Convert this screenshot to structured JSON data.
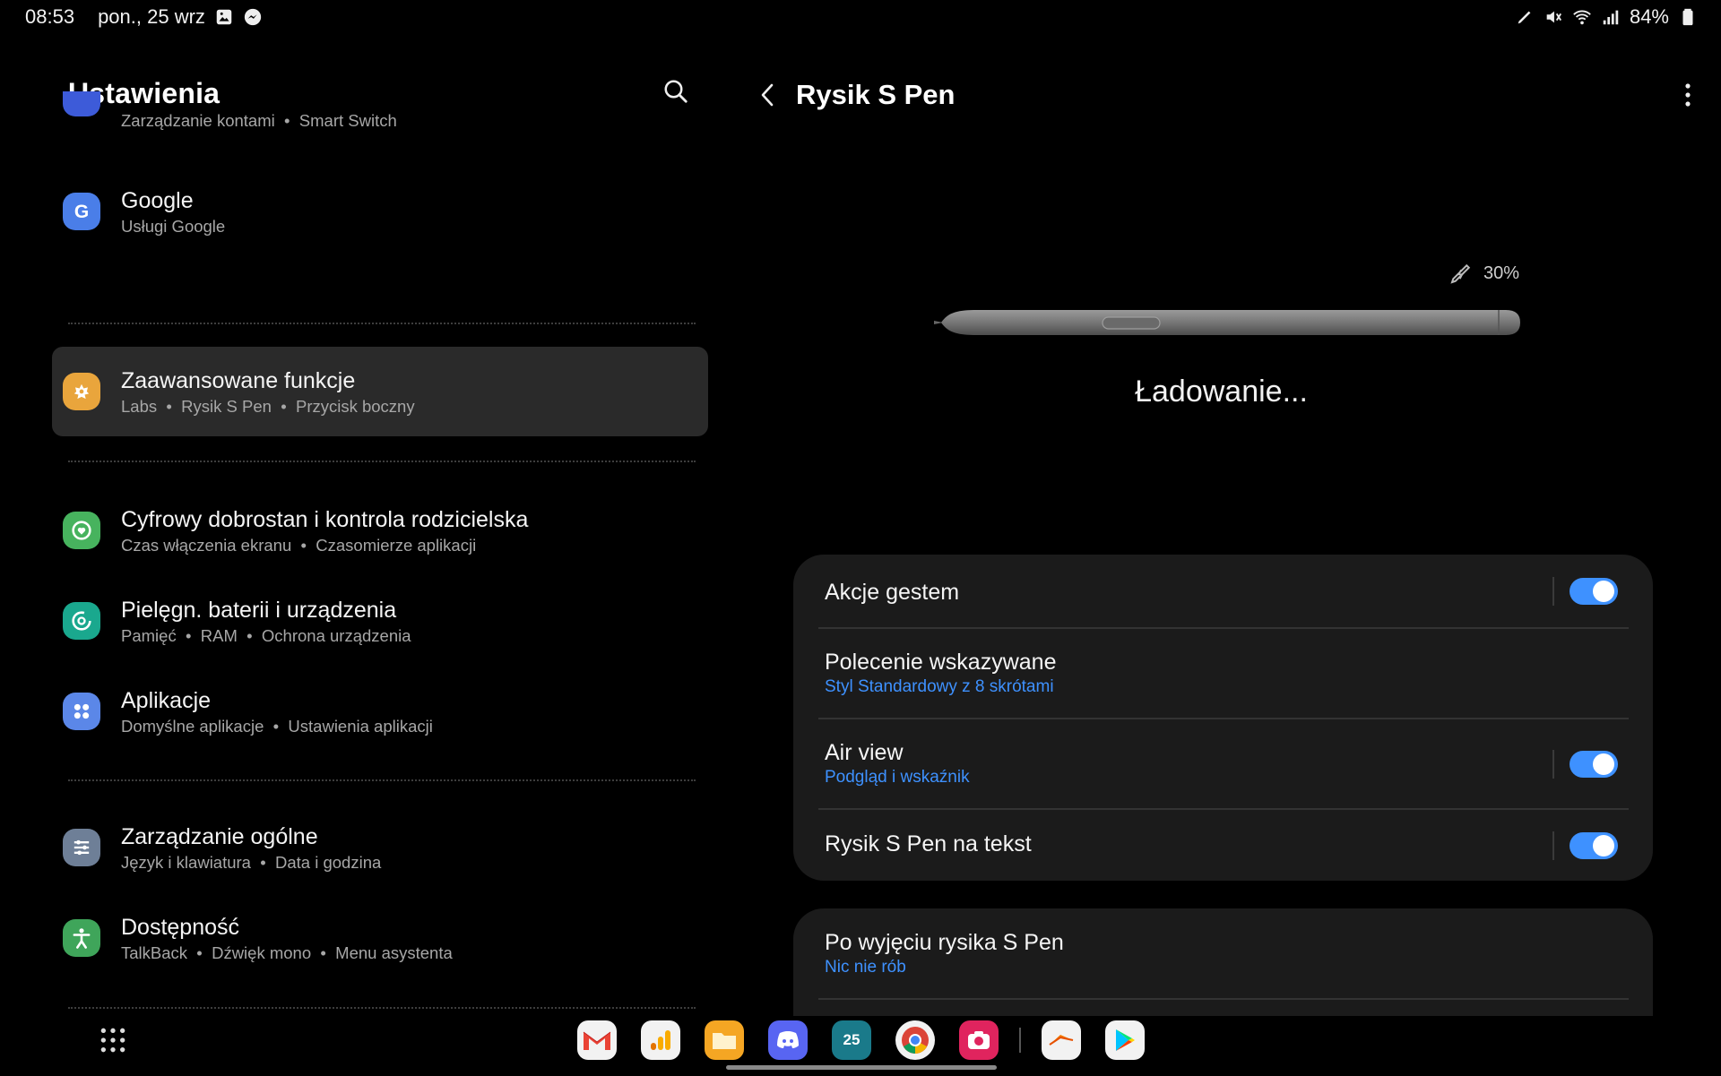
{
  "status_bar": {
    "time": "08:53",
    "date": "pon., 25 wrz",
    "battery": "84%"
  },
  "left": {
    "title": "Ustawienia",
    "items": [
      {
        "title": "",
        "subtitle_parts": [
          "Zarządzanie kontami",
          "Smart Switch"
        ],
        "icon": "accounts-icon",
        "color": "#3d5bd9"
      },
      {
        "title": "Google",
        "subtitle_parts": [
          "Usługi Google"
        ],
        "icon": "google-icon",
        "color": "#4a7ee8"
      },
      {
        "title": "Zaawansowane funkcje",
        "subtitle_parts": [
          "Labs",
          "Rysik S Pen",
          "Przycisk boczny"
        ],
        "icon": "advanced-features-icon",
        "color": "#e9a53c",
        "active": true
      },
      {
        "title": "Cyfrowy dobrostan i kontrola rodzicielska",
        "subtitle_parts": [
          "Czas włączenia ekranu",
          "Czasomierze aplikacji"
        ],
        "icon": "wellbeing-icon",
        "color": "#47b35e"
      },
      {
        "title": "Pielęgn. baterii i urządzenia",
        "subtitle_parts": [
          "Pamięć",
          "RAM",
          "Ochrona urządzenia"
        ],
        "icon": "device-care-icon",
        "color": "#1aa88e"
      },
      {
        "title": "Aplikacje",
        "subtitle_parts": [
          "Domyślne aplikacje",
          "Ustawienia aplikacji"
        ],
        "icon": "apps-icon",
        "color": "#5b87e8"
      },
      {
        "title": "Zarządzanie ogólne",
        "subtitle_parts": [
          "Język i klawiatura",
          "Data i godzina"
        ],
        "icon": "general-management-icon",
        "color": "#6e7f97"
      },
      {
        "title": "Dostępność",
        "subtitle_parts": [
          "TalkBack",
          "Dźwięk mono",
          "Menu asystenta"
        ],
        "icon": "accessibility-icon",
        "color": "#3fa55a"
      }
    ]
  },
  "right": {
    "title": "Rysik S Pen",
    "battery_percent": "30%",
    "status": "Ładowanie...",
    "card1": [
      {
        "title": "Akcje gestem",
        "subtitle": "",
        "toggle": true
      },
      {
        "title": "Polecenie wskazywane",
        "subtitle": "Styl Standardowy z 8 skrótami",
        "toggle": null
      },
      {
        "title": "Air view",
        "subtitle": "Podgląd i wskaźnik",
        "toggle": true
      },
      {
        "title": "Rysik S Pen na tekst",
        "subtitle": "",
        "toggle": true
      }
    ],
    "card2": [
      {
        "title": "Po wyjęciu rysika S Pen",
        "subtitle": "Nic nie rób"
      }
    ]
  },
  "dock": {
    "calendar_day": "25",
    "apps": [
      "gmail-icon",
      "analytics-icon",
      "files-icon",
      "discord-icon",
      "calendar-icon",
      "chrome-icon",
      "camera-icon",
      "swiftkey-icon",
      "play-store-icon"
    ]
  }
}
